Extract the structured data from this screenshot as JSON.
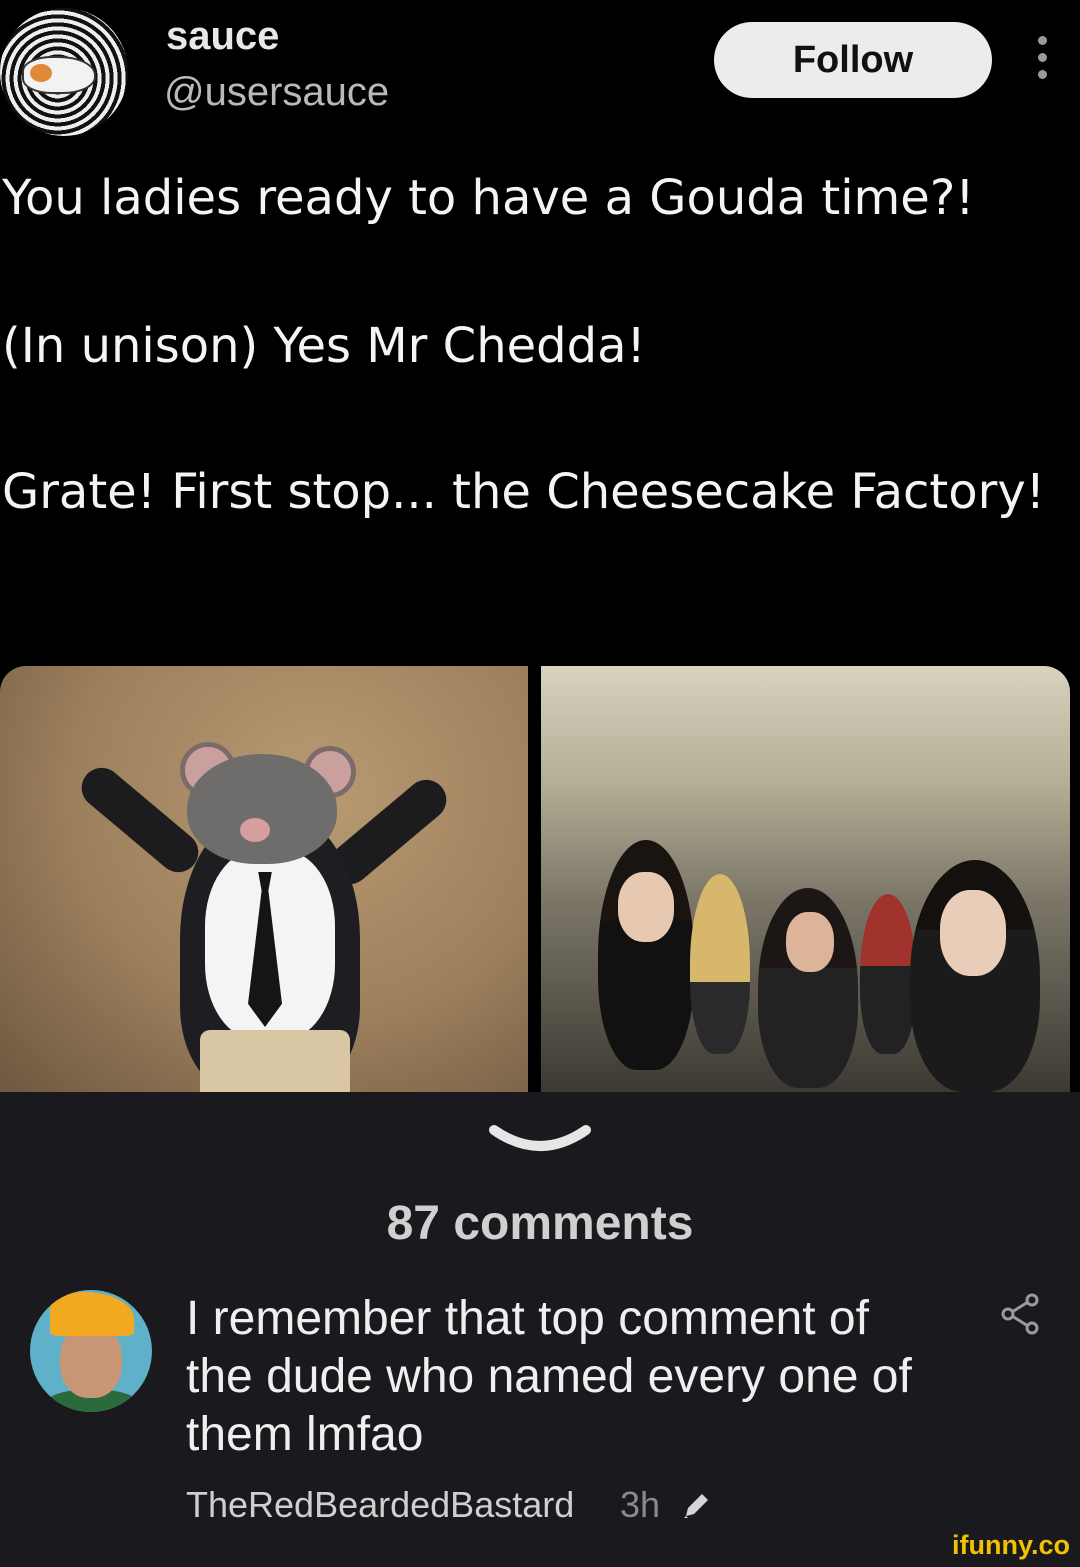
{
  "header": {
    "display_name": "sauce",
    "handle": "@usersauce",
    "follow_label": "Follow"
  },
  "tweet": {
    "lines": [
      "You ladies ready to have a Gouda time?!",
      "(In unison) Yes Mr Chedda!",
      "Grate! First stop... the Cheesecake Factory!"
    ]
  },
  "comments": {
    "count_label": "87 comments",
    "items": [
      {
        "text": "I remember that top comment of the dude who named every one of them lmfao",
        "author": "TheRedBeardedBastard",
        "time": "3h"
      }
    ]
  },
  "watermark": "ifunny.co",
  "icons": [
    "more-vertical-icon",
    "chevron-down-icon",
    "share-icon",
    "pencil-icon"
  ],
  "colors": {
    "background": "#000000",
    "comments_bg": "#1a1a1e",
    "follow_bg": "#ececec",
    "watermark": "#f2c200"
  }
}
